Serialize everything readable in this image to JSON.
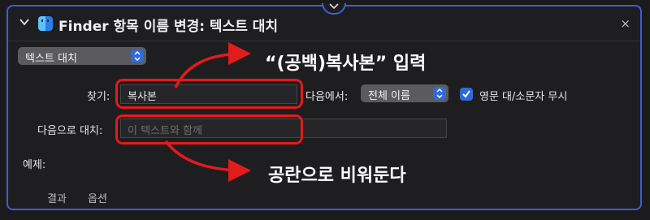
{
  "header": {
    "title": "Finder 항목 이름 변경: 텍스트 대치",
    "close_glyph": "×"
  },
  "action_type": {
    "selected": "텍스트 대치"
  },
  "find": {
    "label": "찾기:",
    "value": "복사본"
  },
  "where": {
    "label": "다음에서:",
    "selected": "전체 이름"
  },
  "ignore_case": {
    "label": "영문 대/소문자 무시",
    "checked": true
  },
  "replace": {
    "label": "다음으로 대치:",
    "placeholder": "이 텍스트와 함께",
    "value": ""
  },
  "example": {
    "label": "예제:"
  },
  "footer_tabs": [
    "결과",
    "옵션"
  ],
  "annotations": {
    "top": "“(공백)복사본” 입력",
    "bottom": "공란으로 비워둔다"
  },
  "colors": {
    "accent": "#2f6bd6",
    "panel_border": "#3c5fd0",
    "annotation_red": "#e21b1b"
  }
}
